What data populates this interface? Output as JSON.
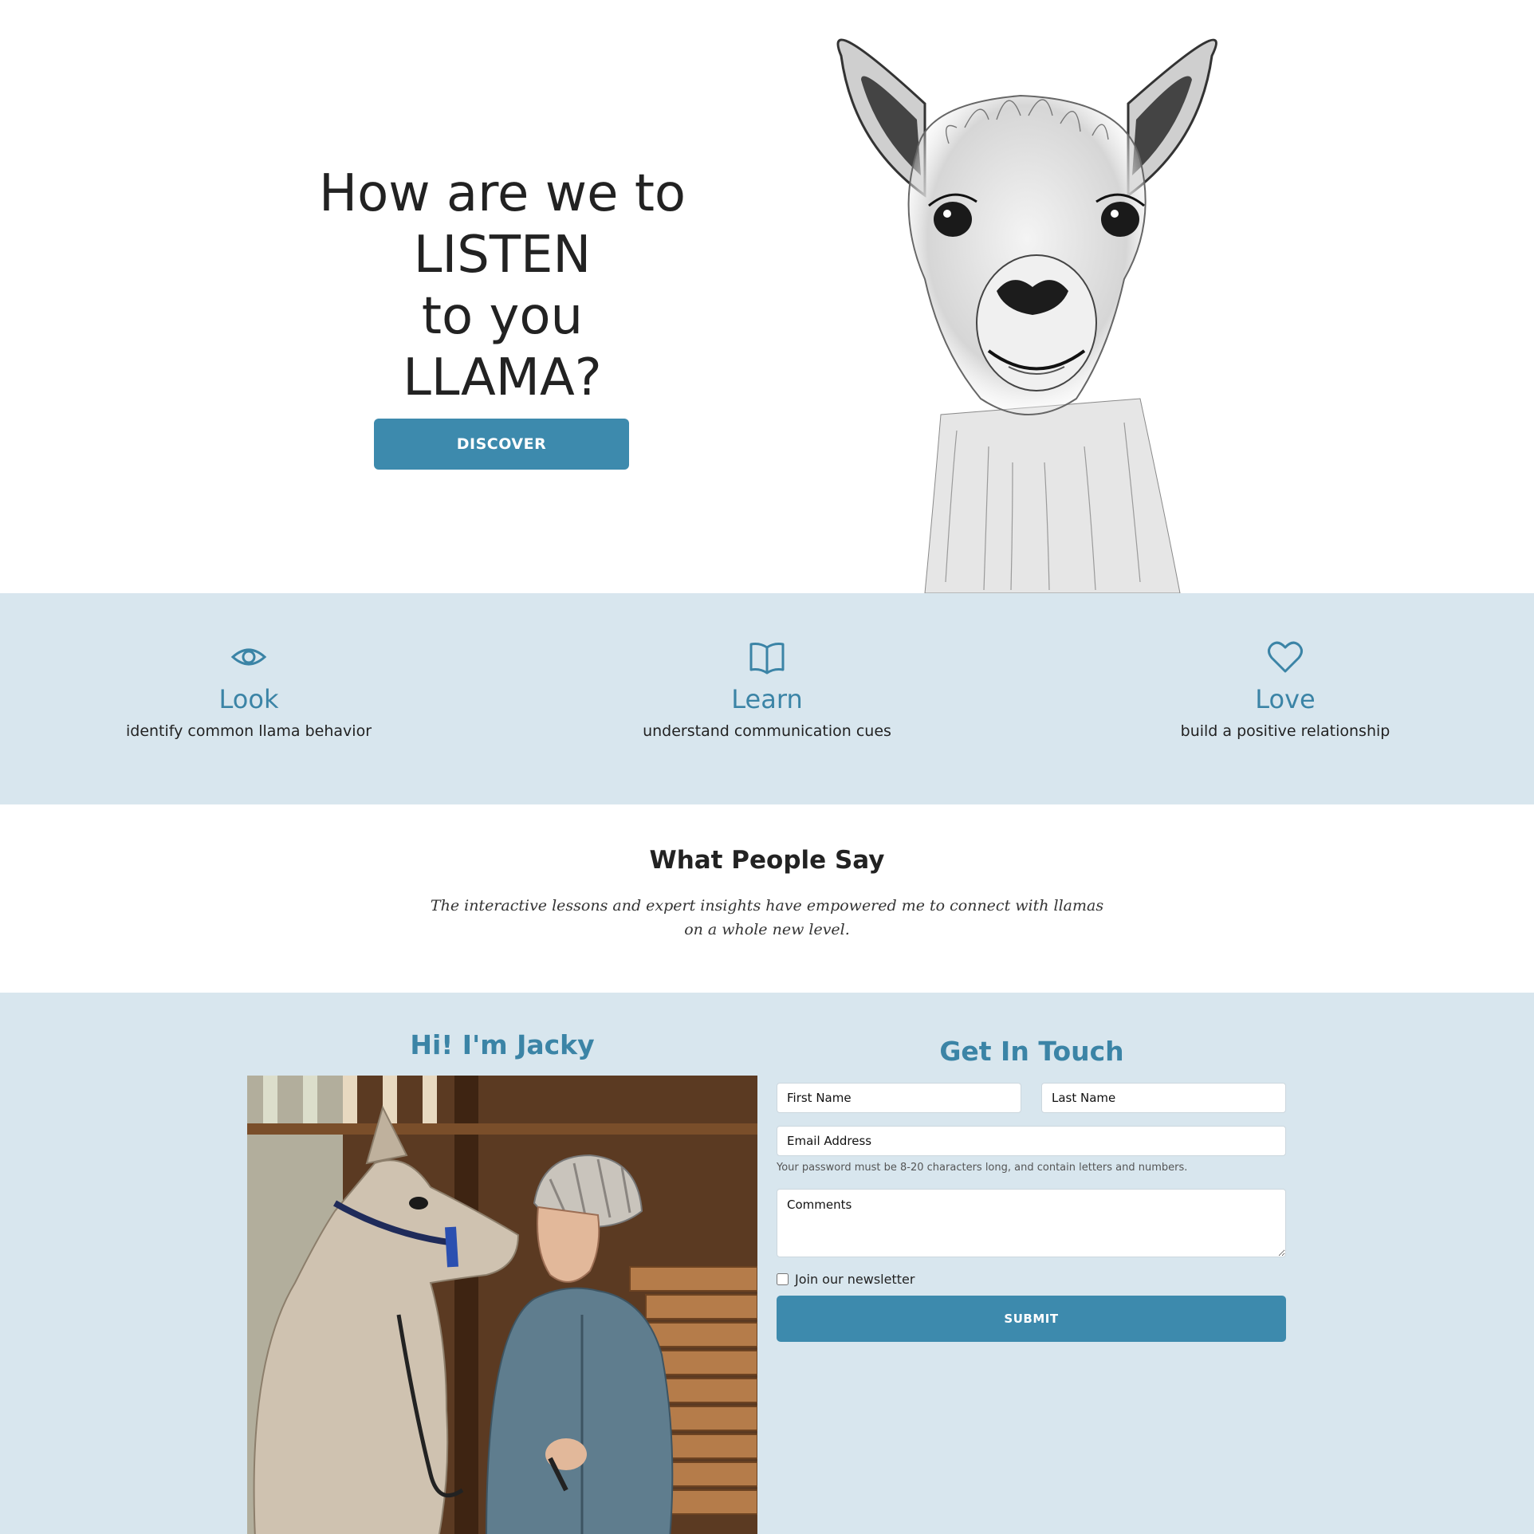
{
  "hero": {
    "heading_lines": [
      "How are we to",
      "LISTEN",
      "to you",
      "LLAMA?"
    ],
    "cta_label": "DISCOVER",
    "image": "llama-sketch-illustration"
  },
  "features": [
    {
      "icon": "eye-icon",
      "title": "Look",
      "description": "identify common llama behavior"
    },
    {
      "icon": "book-icon",
      "title": "Learn",
      "description": "understand communication cues"
    },
    {
      "icon": "heart-icon",
      "title": "Love",
      "description": "build a positive relationship"
    }
  ],
  "testimonial": {
    "title": "What People Say",
    "quote": "The interactive lessons and expert insights have empowered me to connect with llamas on a whole new level."
  },
  "about": {
    "title": "Hi! I'm Jacky",
    "photo": "jacky-with-llama-photo"
  },
  "contact": {
    "title": "Get In Touch",
    "first_name_placeholder": "First Name",
    "last_name_placeholder": "Last Name",
    "email_placeholder": "Email Address",
    "email_help": "Your password must be 8-20 characters long, and contain letters and numbers.",
    "comments_placeholder": "Comments",
    "newsletter_label": "Join our newsletter",
    "newsletter_checked": false,
    "submit_label": "SUBMIT"
  },
  "colors": {
    "accent": "#3d8aad",
    "section_bg": "#d8e6ee",
    "text": "#222222"
  }
}
